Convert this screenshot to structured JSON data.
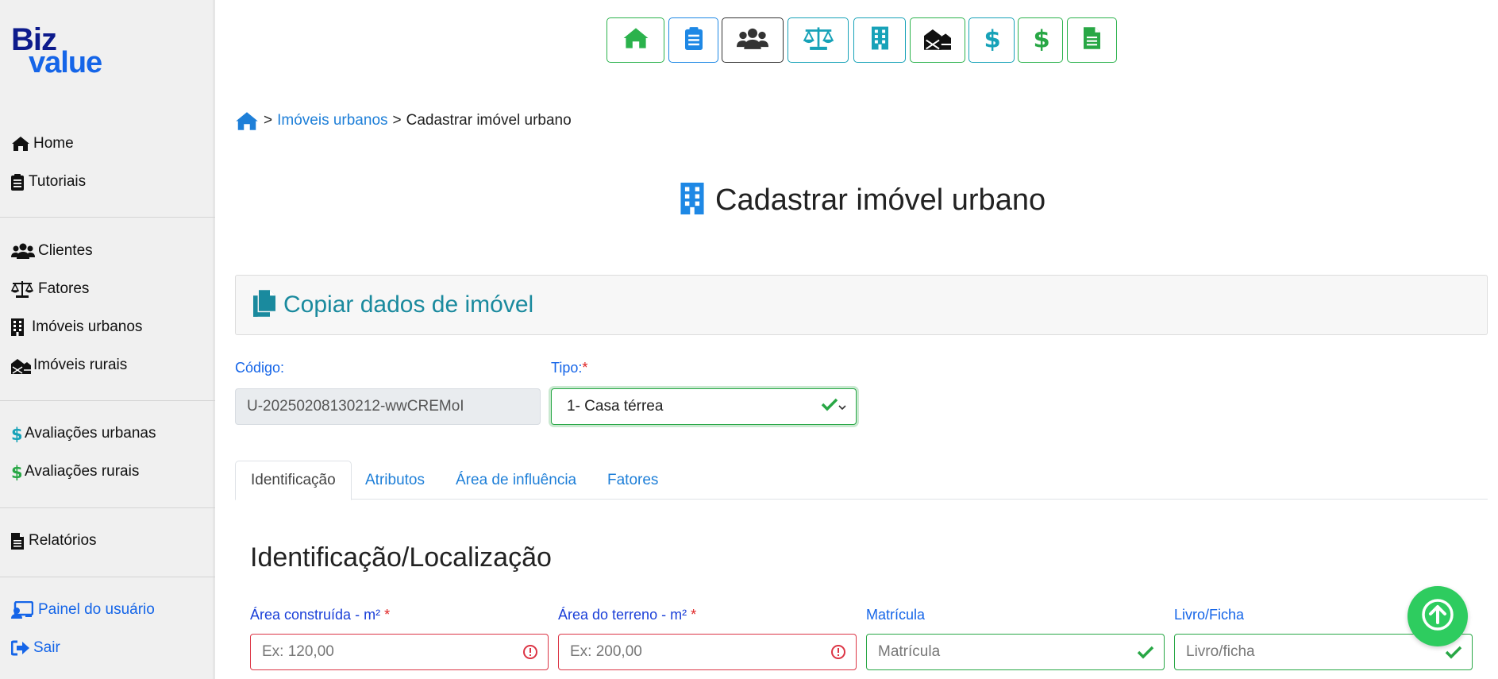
{
  "brand": {
    "part1": "Biz",
    "part2": "value"
  },
  "sidebar": {
    "items": [
      {
        "label": "Home",
        "icon": "home-icon"
      },
      {
        "label": "Tutoriais",
        "icon": "clipboard-icon"
      },
      {
        "label": "Clientes",
        "icon": "users-icon"
      },
      {
        "label": "Fatores",
        "icon": "balance-scale-icon"
      },
      {
        "label": "Imóveis urbanos",
        "icon": "building-icon"
      },
      {
        "label": "Imóveis rurais",
        "icon": "farm-icon"
      },
      {
        "label": "Avaliações urbanas",
        "icon": "dollar-icon"
      },
      {
        "label": "Avaliações rurais",
        "icon": "dollar-icon"
      },
      {
        "label": "Relatórios",
        "icon": "file-icon"
      },
      {
        "label": "Painel do usuário",
        "icon": "user-panel-icon"
      },
      {
        "label": "Sair",
        "icon": "sign-out-icon"
      }
    ]
  },
  "toolbar": {
    "buttons": [
      "home-icon",
      "clipboard-icon",
      "users-icon",
      "balance-scale-icon",
      "building-icon",
      "farm-icon",
      "dollar-icon",
      "dollar-icon",
      "file-icon"
    ]
  },
  "breadcrumb": {
    "sep1": ">",
    "link": "Imóveis urbanos",
    "sep2": ">",
    "current": "Cadastrar imóvel urbano"
  },
  "page": {
    "title": "Cadastrar imóvel urbano"
  },
  "copy_panel": {
    "title": "Copiar dados de imóvel"
  },
  "form": {
    "codigo": {
      "label": "Código:",
      "value": "U-20250208130212-wwCREMoI"
    },
    "tipo": {
      "label": "Tipo:",
      "required": "*",
      "value": "1- Casa térrea"
    }
  },
  "tabs": [
    "Identificação",
    "Atributos",
    "Área de influência",
    "Fatores"
  ],
  "section": {
    "title": "Identificação/Localização"
  },
  "fields": {
    "area_construida": {
      "label": "Área construída - m²",
      "required": "*",
      "placeholder": "Ex: 120,00"
    },
    "area_terreno": {
      "label": "Área do terreno - m²",
      "required": "*",
      "placeholder": "Ex: 200,00"
    },
    "matricula": {
      "label": "Matrícula",
      "placeholder": "Matrícula"
    },
    "livro_ficha": {
      "label": "Livro/Ficha",
      "placeholder": "Livro/ficha"
    }
  },
  "colors": {
    "accent": "#1565e8",
    "success": "#28a745",
    "danger": "#dc3545",
    "teal": "#17a2b8"
  }
}
